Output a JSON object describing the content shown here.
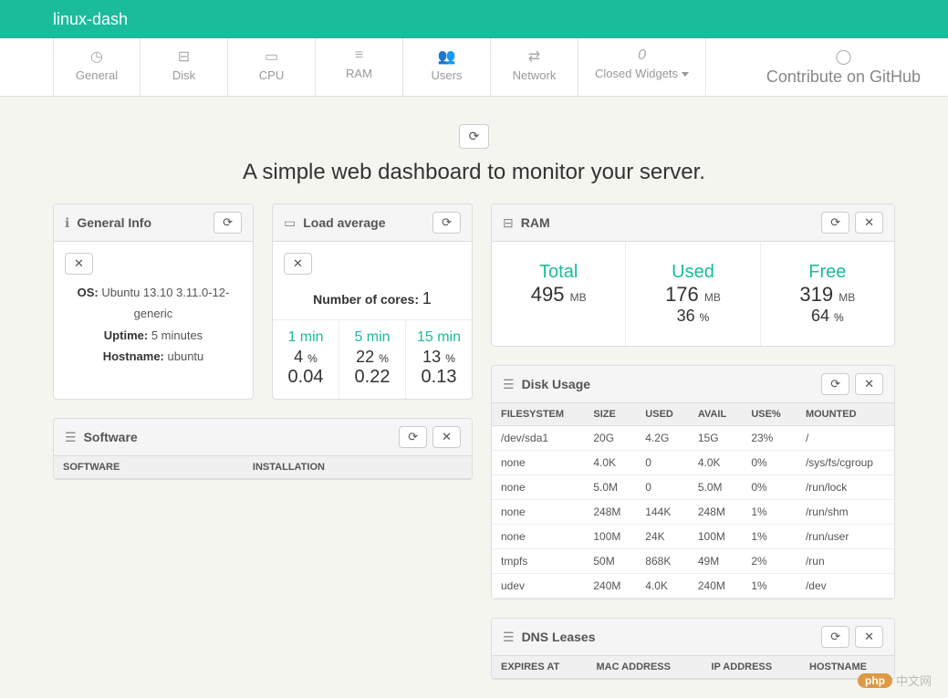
{
  "brand": "linux-dash",
  "nav": [
    {
      "label": "General",
      "icon": "dashboard-icon"
    },
    {
      "label": "Disk",
      "icon": "hdd-icon"
    },
    {
      "label": "CPU",
      "icon": "laptop-icon"
    },
    {
      "label": "RAM",
      "icon": "tasks-icon"
    },
    {
      "label": "Users",
      "icon": "users-icon"
    },
    {
      "label": "Network",
      "icon": "exchange-icon"
    },
    {
      "label": "Closed Widgets",
      "icon": "italic-o-icon",
      "dropdown": true
    }
  ],
  "contribute": "Contribute on GitHub",
  "hero": "A simple web dashboard to monitor your server.",
  "general_info": {
    "title": "General Info",
    "os_label": "OS:",
    "os": "Ubuntu 13.10 3.11.0-12-generic",
    "uptime_label": "Uptime:",
    "uptime": "5 minutes",
    "hostname_label": "Hostname:",
    "hostname": "ubuntu"
  },
  "load": {
    "title": "Load average",
    "cores_label": "Number of cores:",
    "cores": "1",
    "cols": [
      {
        "label": "1 min",
        "pct": "4",
        "val": "0.04"
      },
      {
        "label": "5 min",
        "pct": "22",
        "val": "0.22"
      },
      {
        "label": "15 min",
        "pct": "13",
        "val": "0.13"
      }
    ]
  },
  "ram": {
    "title": "RAM",
    "cells": [
      {
        "label": "Total",
        "value": "495",
        "unit": "MB",
        "pct": ""
      },
      {
        "label": "Used",
        "value": "176",
        "unit": "MB",
        "pct": "36"
      },
      {
        "label": "Free",
        "value": "319",
        "unit": "MB",
        "pct": "64"
      }
    ]
  },
  "disk": {
    "title": "Disk Usage",
    "headers": [
      "FILESYSTEM",
      "SIZE",
      "USED",
      "AVAIL",
      "USE%",
      "MOUNTED"
    ],
    "rows": [
      [
        "/dev/sda1",
        "20G",
        "4.2G",
        "15G",
        "23%",
        "/"
      ],
      [
        "none",
        "4.0K",
        "0",
        "4.0K",
        "0%",
        "/sys/fs/cgroup"
      ],
      [
        "none",
        "5.0M",
        "0",
        "5.0M",
        "0%",
        "/run/lock"
      ],
      [
        "none",
        "248M",
        "144K",
        "248M",
        "1%",
        "/run/shm"
      ],
      [
        "none",
        "100M",
        "24K",
        "100M",
        "1%",
        "/run/user"
      ],
      [
        "tmpfs",
        "50M",
        "868K",
        "49M",
        "2%",
        "/run"
      ],
      [
        "udev",
        "240M",
        "4.0K",
        "240M",
        "1%",
        "/dev"
      ]
    ]
  },
  "software": {
    "title": "Software",
    "headers": [
      "SOFTWARE",
      "INSTALLATION"
    ]
  },
  "dns": {
    "title": "DNS Leases",
    "headers": [
      "EXPIRES AT",
      "MAC ADDRESS",
      "IP ADDRESS",
      "HOSTNAME"
    ]
  },
  "watermark": "中文网",
  "watermark_prefix": "php"
}
